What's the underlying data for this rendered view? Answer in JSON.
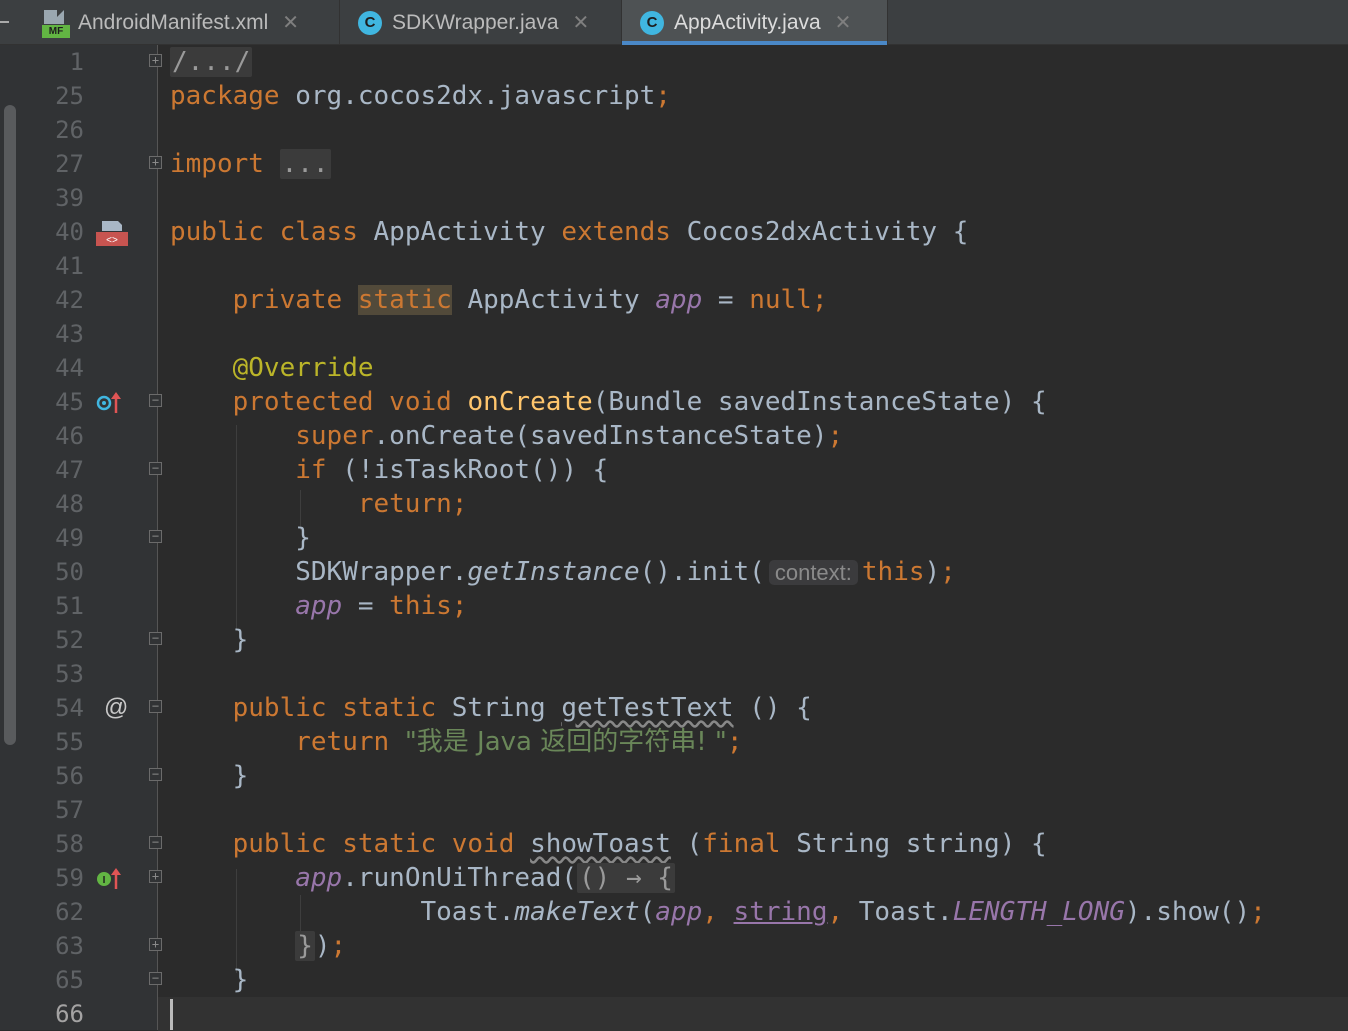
{
  "tabs": [
    {
      "icon": "MF",
      "label": "AndroidManifest.xml",
      "close": "✕",
      "active": false
    },
    {
      "icon": "C",
      "label": "SDKWrapper.java",
      "close": "✕",
      "active": false
    },
    {
      "icon": "C",
      "label": "AppActivity.java",
      "close": "✕",
      "active": true
    }
  ],
  "line_numbers": [
    "1",
    "25",
    "26",
    "27",
    "39",
    "40",
    "41",
    "42",
    "43",
    "44",
    "45",
    "46",
    "47",
    "48",
    "49",
    "50",
    "51",
    "52",
    "53",
    "54",
    "55",
    "56",
    "57",
    "58",
    "59",
    "62",
    "63",
    "65",
    "66"
  ],
  "gutter_markers": {
    "line_54": "@",
    "line_45": "o↑",
    "line_59": "I↑"
  },
  "code": {
    "l1_collapsed": "/.../",
    "l25_kw": "package",
    "l25_pkg": " org.cocos2dx.javascript",
    "l25_semi": ";",
    "l27_kw": "import",
    "l27_collapsed": "...",
    "l40_kw1": "public",
    "l40_kw2": "class",
    "l40_name": "AppActivity",
    "l40_kw3": "extends",
    "l40_super": "Cocos2dxActivity {",
    "l42_kw1": "private",
    "l42_kw2": "static",
    "l42_type": "AppActivity",
    "l42_field": "app",
    "l42_eq": " = ",
    "l42_null": "null;",
    "l44_ann": "@Override",
    "l45_kw1": "protected",
    "l45_kw2": "void",
    "l45_fn": "onCreate",
    "l45_rest": "(Bundle savedInstanceState) {",
    "l46_kw": "super",
    "l46_rest": ".onCreate(savedInstanceState)",
    "l46_semi": ";",
    "l47_kw": "if",
    "l47_rest": " (!isTaskRoot()) {",
    "l48_kw": "return;",
    "l49_brace": "}",
    "l50_a": "SDKWrapper.",
    "l50_b": "getInstance",
    "l50_c": "().init(",
    "l50_hint": "context:",
    "l50_this": "this",
    "l50_d": ")",
    "l50_semi": ";",
    "l51_field": "app",
    "l51_eq": " = ",
    "l51_this": "this;",
    "l52_brace": "}",
    "l54_kw1": "public",
    "l54_kw2": "static",
    "l54_type": "String",
    "l54_fn": "getTestText",
    "l54_rest": " () {",
    "l55_kw": "return",
    "l55_str": "\"我是 Java 返回的字符串! \"",
    "l55_semi": ";",
    "l56_brace": "}",
    "l58_kw1": "public",
    "l58_kw2": "static",
    "l58_kw3": "void",
    "l58_fn": "showToast",
    "l58_a": " (",
    "l58_kw4": "final",
    "l58_rest": " String string) {",
    "l59_field": "app",
    "l59_rest": ".runOnUiThread(",
    "l59_collapsed": "() → {",
    "l62_a": "Toast.",
    "l62_fn": "makeText",
    "l62_b": "(",
    "l62_field": "app",
    "l62_comma1": ", ",
    "l62_param": "string",
    "l62_comma2": ", ",
    "l62_c": "Toast.",
    "l62_const": "LENGTH_LONG",
    "l62_d": ").show()",
    "l62_semi": ";",
    "l63_collapsed": "}",
    "l63_rest": ")",
    "l63_semi": ";",
    "l65_brace": "}"
  }
}
